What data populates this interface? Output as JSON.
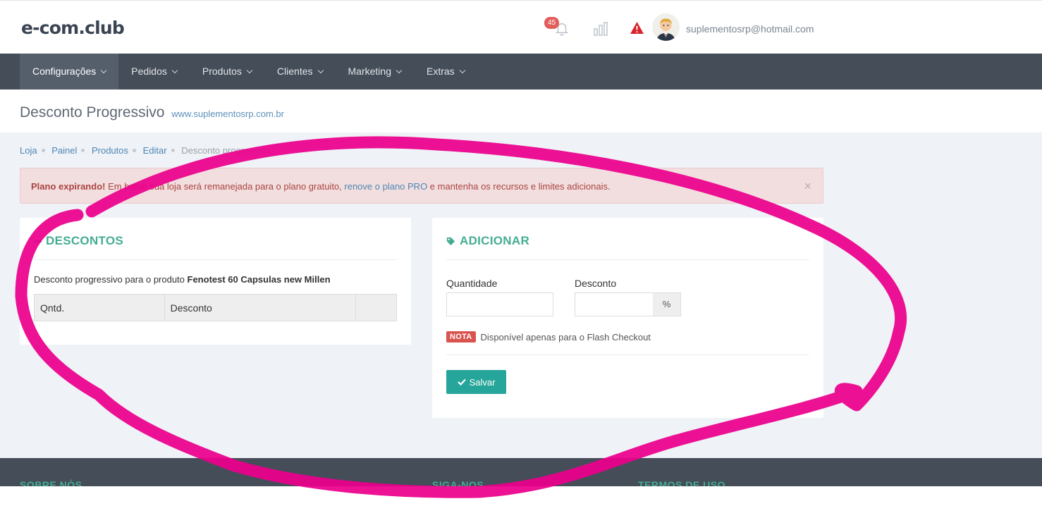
{
  "brand": {
    "logo_text": "e-com.club"
  },
  "header": {
    "notification_count": "45",
    "user_email": "suplementosrp@hotmail.com"
  },
  "nav": {
    "items": [
      {
        "label": "Configurações",
        "active": true
      },
      {
        "label": "Pedidos"
      },
      {
        "label": "Produtos"
      },
      {
        "label": "Clientes"
      },
      {
        "label": "Marketing"
      },
      {
        "label": "Extras"
      }
    ]
  },
  "page": {
    "title": "Desconto Progressivo",
    "domain": "www.suplementosrp.com.br"
  },
  "breadcrumb": {
    "items": [
      "Loja",
      "Painel",
      "Produtos",
      "Editar"
    ],
    "current": "Desconto progressivo"
  },
  "alert": {
    "strong": "Plano expirando!",
    "text_before": " Em breve sua loja será remanejada para o plano gratuito, ",
    "link": "renove o plano PRO",
    "text_after": " e mantenha os recursos e limites adicionais.",
    "close": "×"
  },
  "discounts_panel": {
    "title": "DESCONTOS",
    "desc_prefix": "Desconto progressivo para o produto ",
    "product_name": "Fenotest 60 Capsulas new Millen",
    "columns": [
      "Qntd.",
      "Desconto",
      ""
    ]
  },
  "add_panel": {
    "title": "ADICIONAR",
    "quantity_label": "Quantidade",
    "discount_label": "Desconto",
    "quantity_value": "",
    "discount_value": "",
    "percent_addon": "%",
    "note_badge": "NOTA",
    "note_text": "Disponível apenas para o Flash Checkout",
    "save_label": "Salvar"
  },
  "footer": {
    "about": "SOBRE NÓS",
    "follow": "SIGA-NOS",
    "terms": "TERMOS DE USO"
  },
  "colors": {
    "nav_bg": "#454d59",
    "accent_green": "#45ac93",
    "save_button": "#26a69a",
    "alert_bg": "#f2dede",
    "annotation": "#ec008c"
  }
}
